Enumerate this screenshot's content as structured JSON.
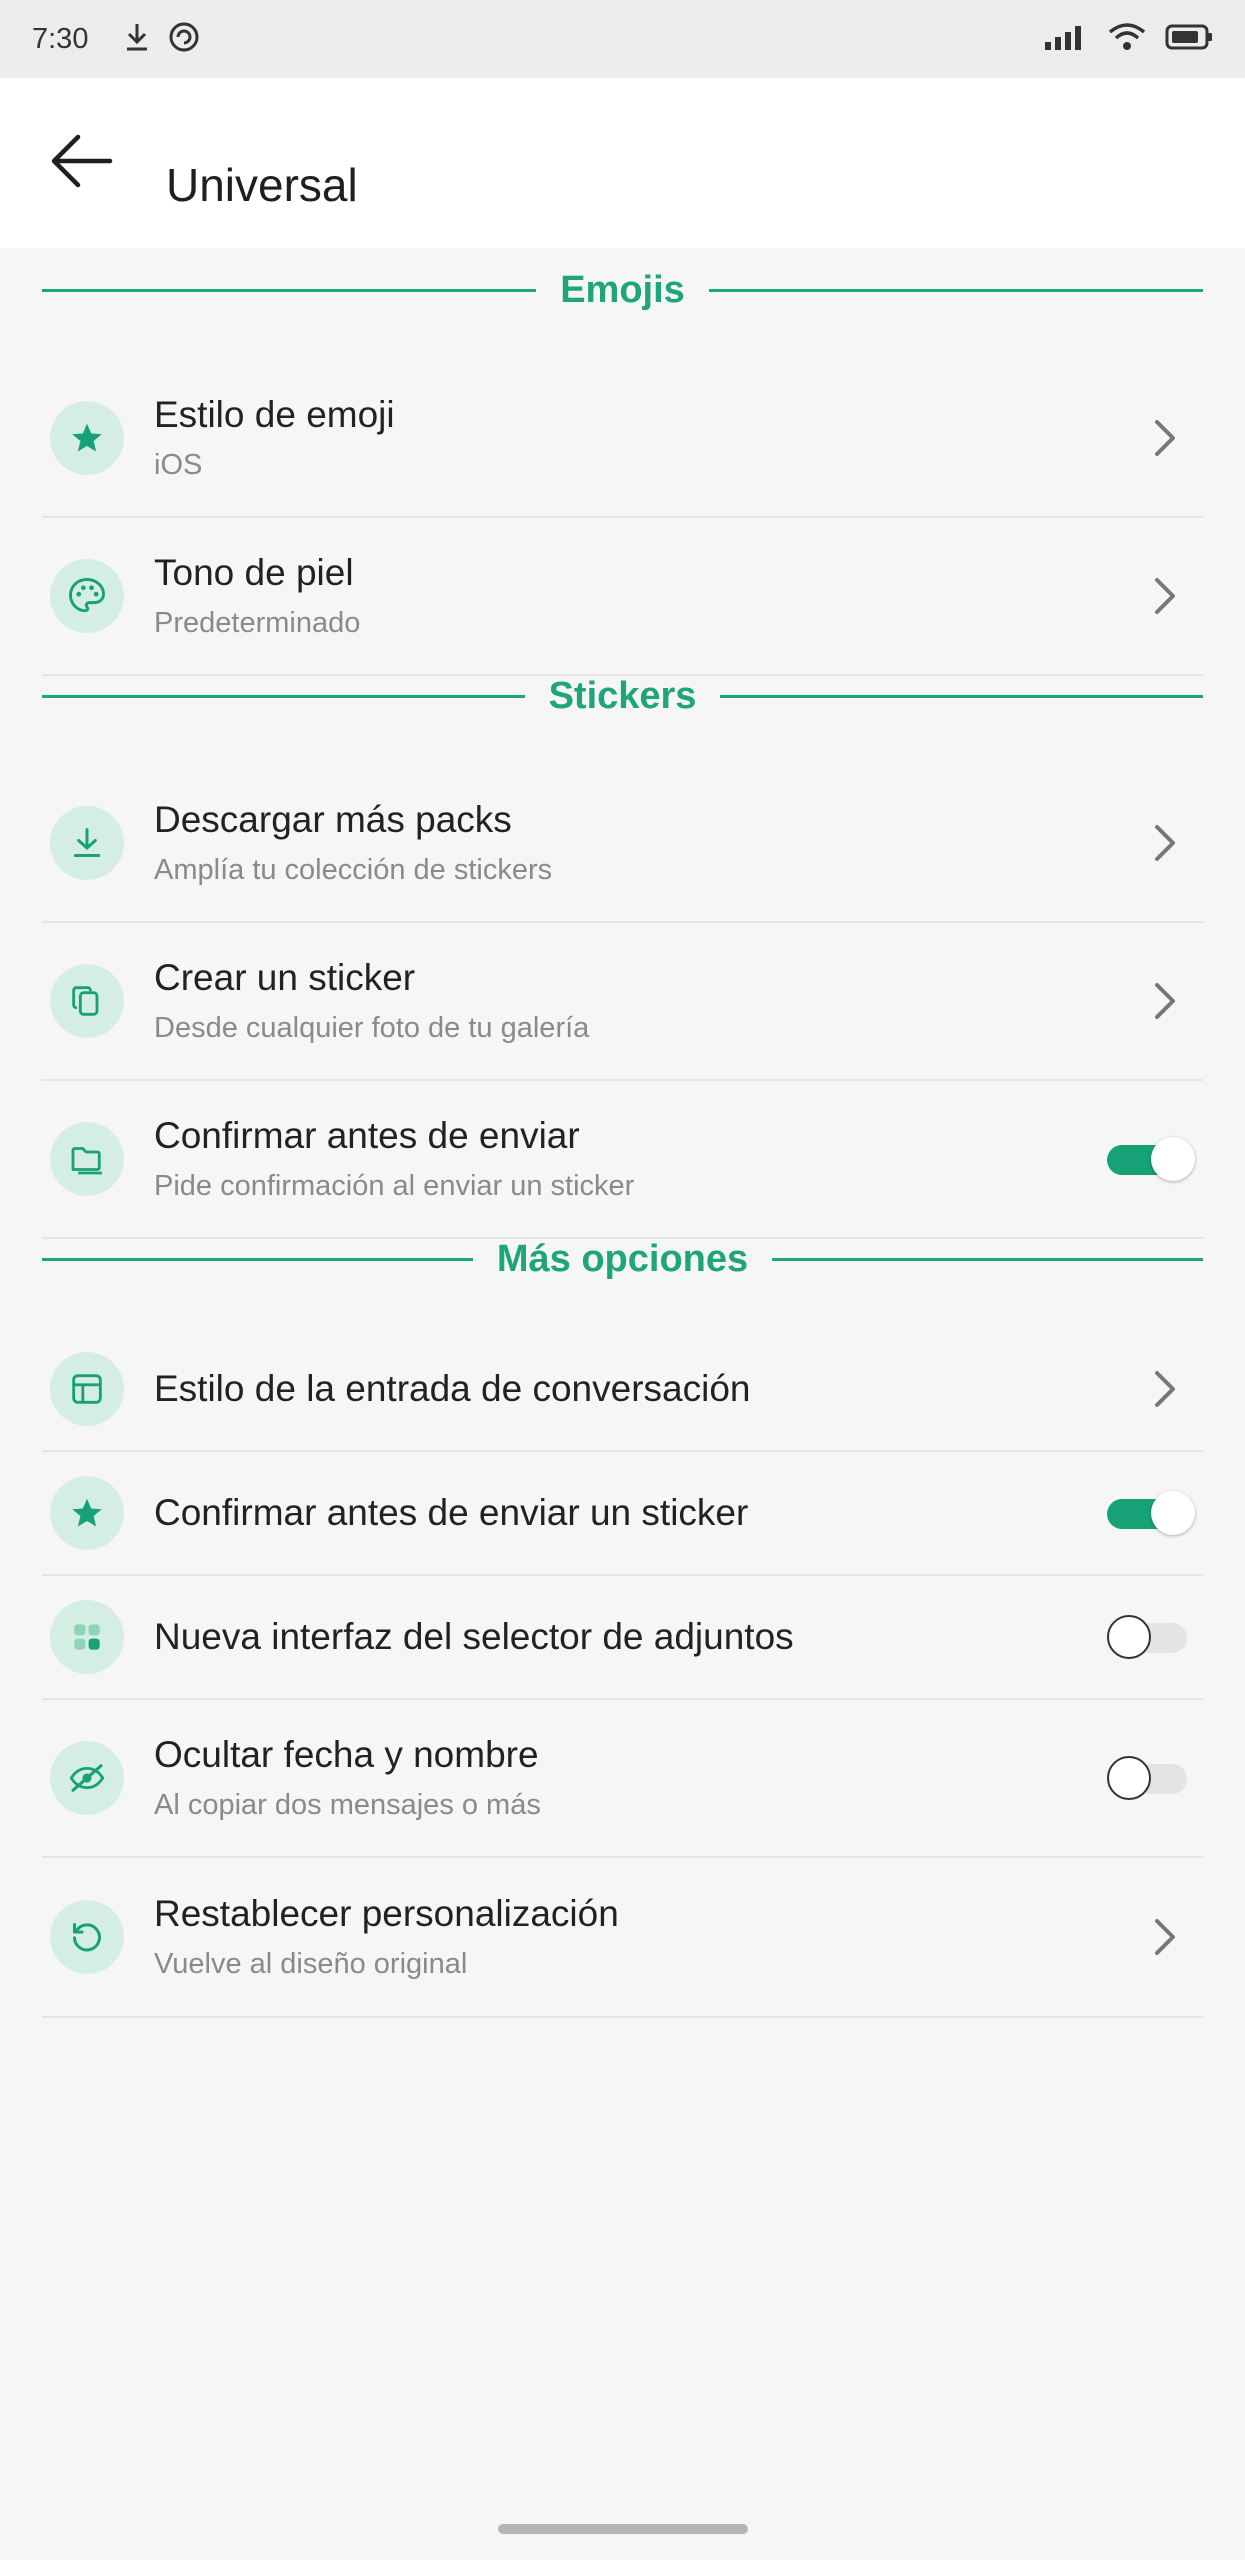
{
  "status_bar": {
    "time": "7:30",
    "left_icons": [
      "download-icon",
      "sync-icon"
    ],
    "right_icons": [
      "signal-icon",
      "wifi-icon",
      "battery-icon"
    ]
  },
  "app_bar": {
    "back_icon": "arrow-left-icon",
    "title": "Universal"
  },
  "accent_color": "#1ea57a",
  "sections": {
    "emojis": {
      "label": "Emojis",
      "items": [
        {
          "title": "Estilo de emoji",
          "subtitle": "iOS",
          "icon": "star-icon",
          "control": "chevron"
        },
        {
          "title": "Tono de piel",
          "subtitle": "Predeterminado",
          "icon": "palette-icon",
          "control": "chevron"
        }
      ]
    },
    "stickers": {
      "label": "Stickers",
      "items": [
        {
          "title": "Descargar más packs",
          "subtitle": "Amplía tu colección de stickers",
          "icon": "download-icon",
          "control": "chevron"
        },
        {
          "title": "Crear un sticker",
          "subtitle": "Desde cualquier foto de tu galería",
          "icon": "copy-icon",
          "control": "chevron"
        },
        {
          "title": "Confirmar antes de enviar",
          "subtitle": "Pide confirmación al enviar un sticker",
          "icon": "folder-icon",
          "control": "toggle",
          "on": true
        }
      ]
    },
    "more": {
      "label": "Más opciones",
      "items": [
        {
          "title": "Estilo de la entrada de conversación",
          "icon": "layout-icon",
          "control": "chevron"
        },
        {
          "title": "Confirmar antes de enviar un sticker",
          "icon": "star-icon",
          "control": "toggle",
          "on": true
        },
        {
          "title": "Nueva interfaz del selector de adjuntos",
          "icon": "grid-icon",
          "control": "toggle",
          "on": false
        },
        {
          "title": "Ocultar fecha y nombre",
          "subtitle": "Al copiar dos mensajes o más",
          "icon": "eye-off-icon",
          "control": "toggle",
          "on": false
        },
        {
          "title": "Restablecer personalización",
          "subtitle": "Vuelve al diseño original",
          "icon": "reset-icon",
          "control": "chevron"
        }
      ]
    }
  }
}
